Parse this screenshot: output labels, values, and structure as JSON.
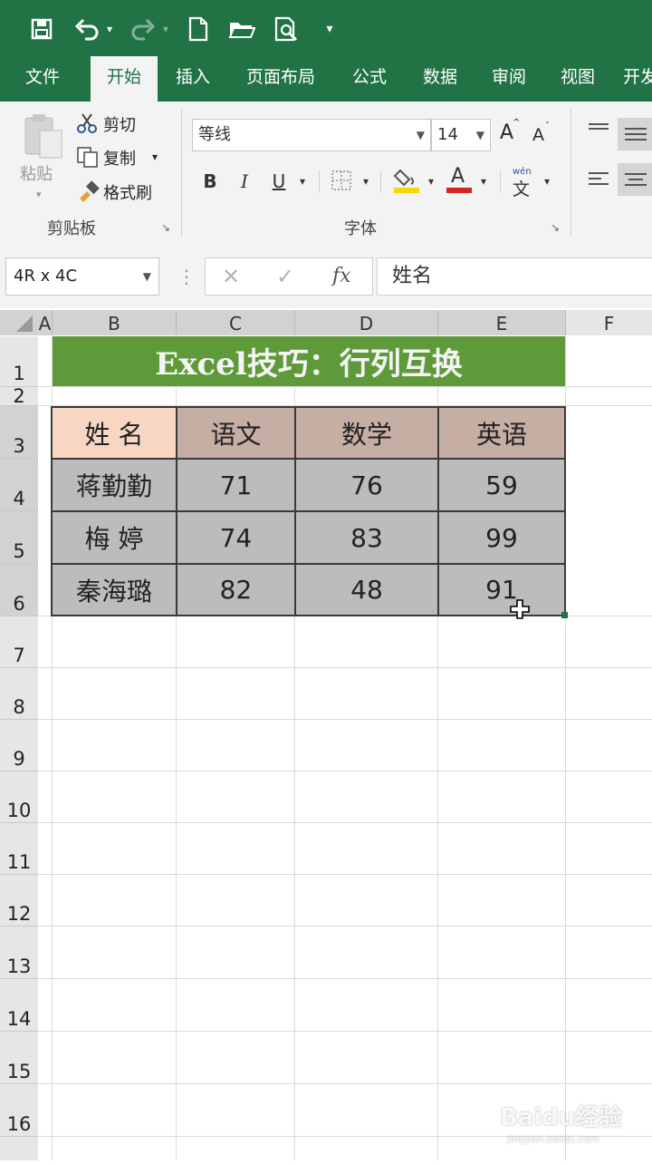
{
  "quick_access": {
    "save_icon": "save-icon",
    "undo_icon": "undo-icon",
    "redo_icon": "redo-icon",
    "new_icon": "new-file-icon",
    "open_icon": "open-folder-icon",
    "preview_icon": "print-preview-icon",
    "customize_icon": "customize-qat-icon"
  },
  "tabs": [
    {
      "label": "文件"
    },
    {
      "label": "开始"
    },
    {
      "label": "插入"
    },
    {
      "label": "页面布局"
    },
    {
      "label": "公式"
    },
    {
      "label": "数据"
    },
    {
      "label": "审阅"
    },
    {
      "label": "视图"
    },
    {
      "label": "开发"
    }
  ],
  "clipboard": {
    "paste": "粘贴",
    "cut": "剪切",
    "copy": "复制",
    "format_painter": "格式刷",
    "group_label": "剪贴板"
  },
  "font": {
    "font_name": "等线",
    "font_size": "14",
    "grow": "A",
    "shrink": "A",
    "bold": "B",
    "italic": "I",
    "underline": "U",
    "font_color_letter": "A",
    "phonetic": "wén",
    "phonetic_char": "文",
    "group_label": "字体",
    "fill_color": "#f5d60f",
    "font_color": "#d32323"
  },
  "formula_bar": {
    "name_box": "4R x 4C",
    "fx": "fx",
    "content": "姓名"
  },
  "columns": [
    "A",
    "B",
    "C",
    "D",
    "E",
    "F"
  ],
  "rows": [
    "1",
    "2",
    "3",
    "4",
    "5",
    "6",
    "7",
    "8",
    "9",
    "10",
    "11",
    "12",
    "13",
    "14",
    "15",
    "16"
  ],
  "sheet": {
    "title": "Excel技巧：行列互换",
    "header": [
      "姓 名",
      "语文",
      "数学",
      "英语"
    ],
    "data": [
      [
        "蒋勤勤",
        "71",
        "76",
        "59"
      ],
      [
        "梅 婷",
        "74",
        "83",
        "99"
      ],
      [
        "秦海璐",
        "82",
        "48",
        "91"
      ]
    ]
  },
  "watermark": {
    "brand": "Baidu经验",
    "url": "jingyan.baidu.com"
  }
}
